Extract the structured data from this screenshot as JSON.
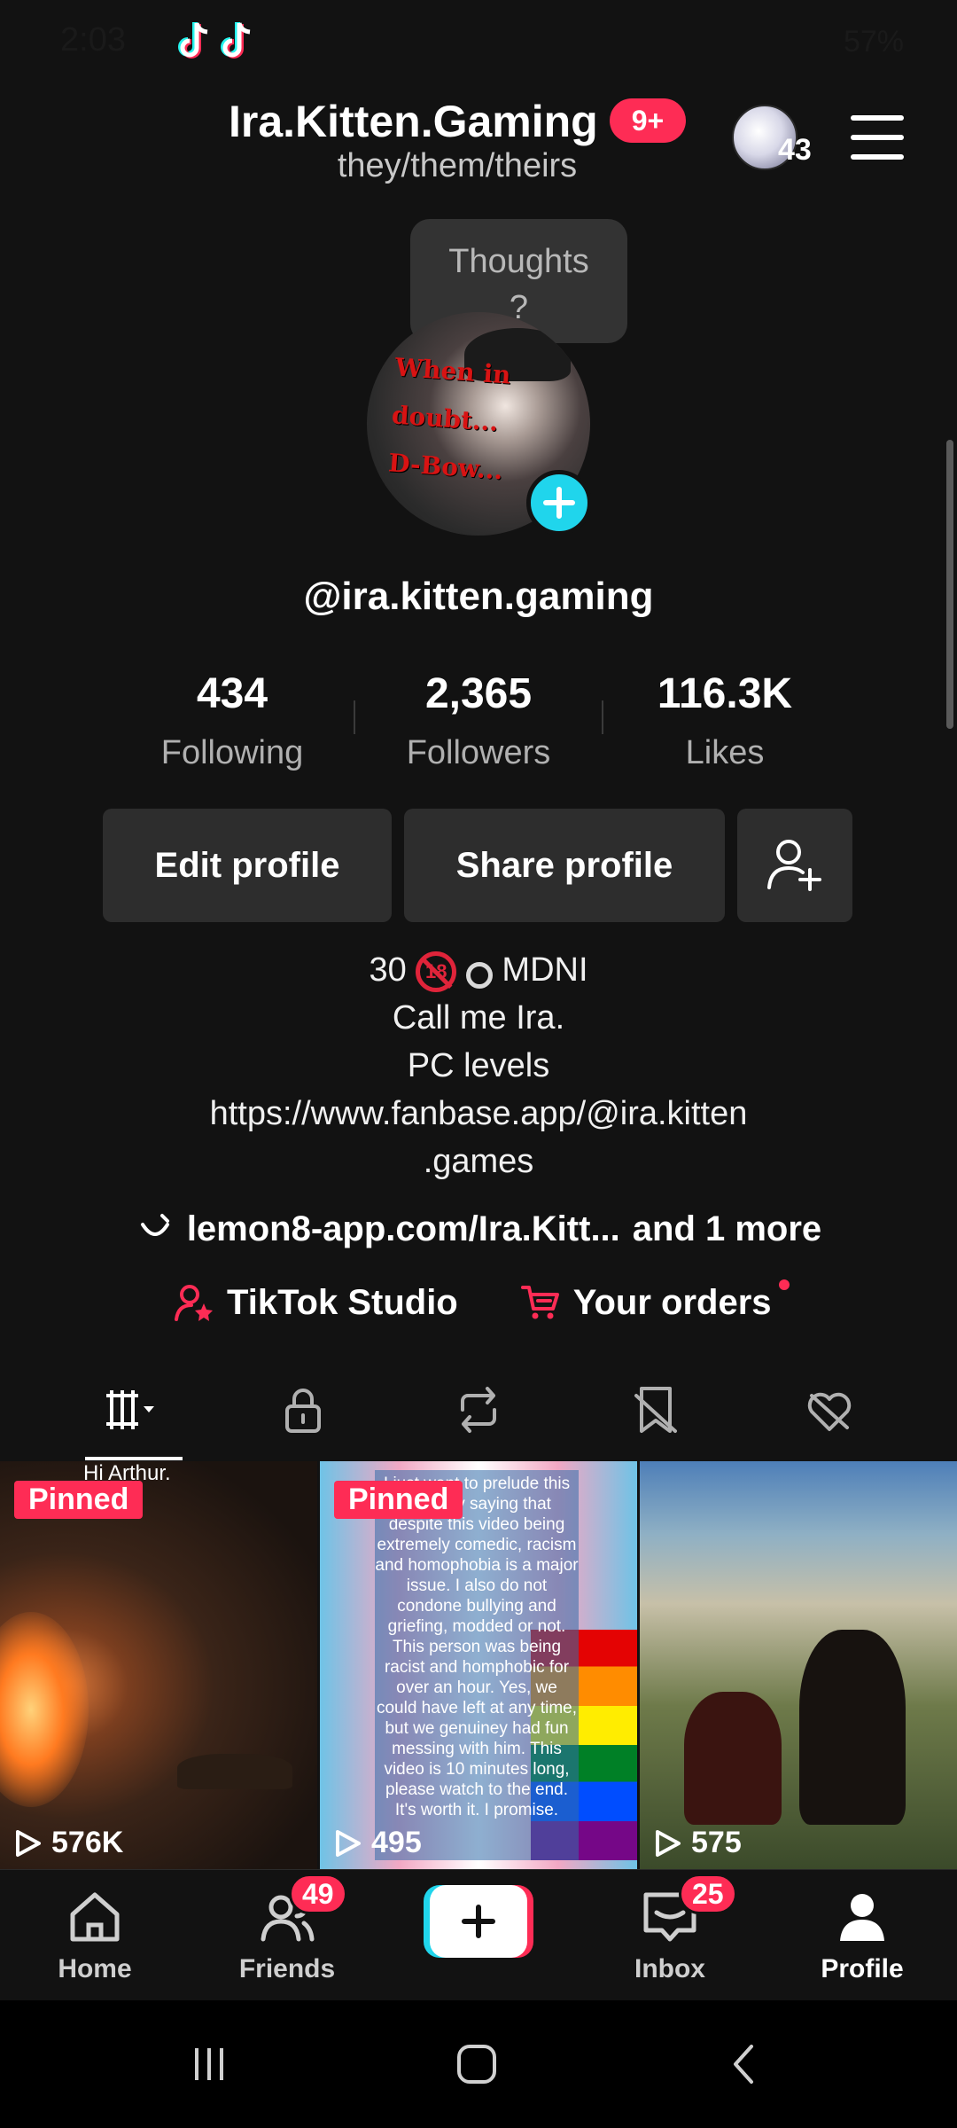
{
  "status_bar": {
    "time": "2:03",
    "right": "57%"
  },
  "header": {
    "display_name": "Ira.Kitten.Gaming",
    "notification_badge": "9+",
    "pronouns": "they/them/theirs",
    "avatar_count": "43",
    "menu_icon": "hamburger-menu-icon"
  },
  "thoughts_bubble": {
    "text": "Thoughts\n?"
  },
  "profile_avatar": {
    "overlay_text": "When in\ndoubt...\nD-Bow...",
    "add_icon": "plus-icon"
  },
  "username": "@ira.kitten.gaming",
  "stats": [
    {
      "value": "434",
      "label": "Following"
    },
    {
      "value": "2,365",
      "label": "Followers"
    },
    {
      "value": "116.3K",
      "label": "Likes"
    }
  ],
  "actions": {
    "edit": "Edit profile",
    "share": "Share profile",
    "add_friend_icon": "add-friend-icon"
  },
  "bio": {
    "line1_age": "30",
    "line1_tag": "MDNI",
    "line2": "Call me Ira.",
    "line3": "PC levels",
    "line4": "https://www.fanbase.app/@ira.kitten",
    "line5": ".games"
  },
  "links": {
    "primary": "lemon8-app.com/Ira.Kitt...",
    "more": "and 1 more"
  },
  "tools": {
    "studio": "TikTok Studio",
    "orders": "Your orders"
  },
  "tabs": [
    {
      "name": "videos-grid",
      "icon": "videos-grid-icon",
      "active": true
    },
    {
      "name": "private",
      "icon": "lock-icon"
    },
    {
      "name": "reposts",
      "icon": "repost-icon"
    },
    {
      "name": "favorites",
      "icon": "bookmark-icon"
    },
    {
      "name": "liked",
      "icon": "heart-icon"
    }
  ],
  "videos": [
    {
      "caption": "Hi Arthur.",
      "pinned": "Pinned",
      "views": "576K"
    },
    {
      "pinned": "Pinned",
      "views": "495",
      "overlay_text": "I just want to prelude this video by saying that despite this video being extremely comedic, racism and homophobia is a major issue. I also do not condone bullying and griefing, modded or not. This person was being racist and homphobic for over an hour. Yes, we could have left at any time, but we genuiney had fun messing with him. This video is 10 minutes long, please watch to the end. It's worth it. I promise."
    },
    {
      "views": "575"
    }
  ],
  "bottom_nav": [
    {
      "label": "Home",
      "icon": "home-icon"
    },
    {
      "label": "Friends",
      "icon": "friends-icon",
      "badge": "49"
    },
    {
      "label": "",
      "icon": "create-plus-icon"
    },
    {
      "label": "Inbox",
      "icon": "inbox-icon",
      "badge": "25"
    },
    {
      "label": "Profile",
      "icon": "profile-icon",
      "active": true
    }
  ],
  "colors": {
    "accent": "#fe2c55",
    "cyan": "#20d5ec",
    "background": "#121212"
  }
}
